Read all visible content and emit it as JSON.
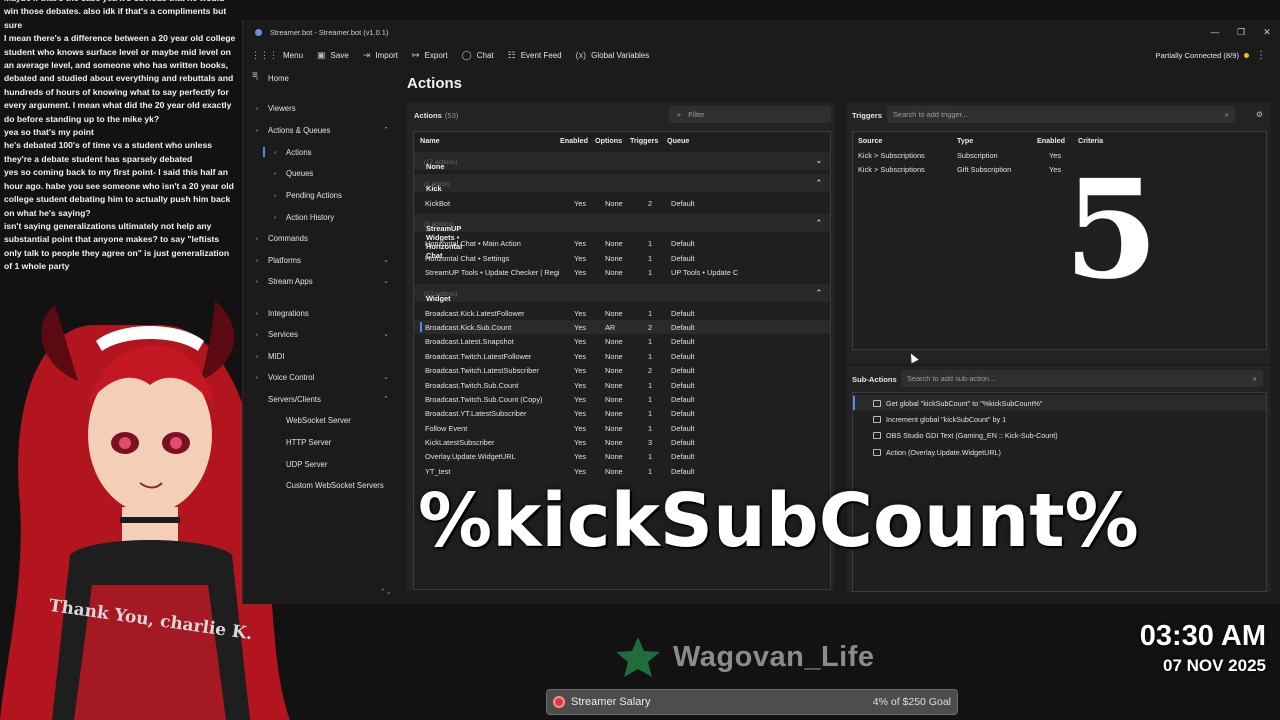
{
  "chat": {
    "messages": [
      "Maybe if that's the case yea it's obvious that he would win those debates. also idk if that's a compliments but sure",
      "I mean there's a difference between a 20 year old college student who knows surface level or maybe mid level on an average level, and someone who has written books, debated and studied about everything and rebuttals and hundreds of hours of knowing what to say perfectly for every argument. I mean what did the 20 year old exactly do before standing up to the mike yk?",
      "yea so that's my point",
      "he's debated 100's of time vs a student who unless they're a debate student has sparsely debated",
      "yes so coming back to my first point- I said this half an hour ago. habe you see someone who isn't a 20 year old college student debating him to actually push him back on what he's saying?",
      "isn't saying generalizations ultimately not help any substantial point that anyone makes? to say \"leftists only talk to people they agree on\" is just generalization of 1 whole party"
    ]
  },
  "window": {
    "title": "Streamer.bot - Streamer.bot (v1.0.1)",
    "controls": [
      "—",
      "❐",
      "✕"
    ]
  },
  "toolbar": {
    "items": [
      {
        "label": "Menu",
        "icon": "grid-icon"
      },
      {
        "label": "Save",
        "icon": "save-icon"
      },
      {
        "label": "Import",
        "icon": "import-icon"
      },
      {
        "label": "Export",
        "icon": "export-icon"
      },
      {
        "label": "Chat",
        "icon": "chat-icon"
      },
      {
        "label": "Event Feed",
        "icon": "event-feed-icon"
      },
      {
        "label": "Global Variables",
        "icon": "variables-icon"
      }
    ],
    "connection_status": "Partially Connected (8/9)",
    "connection_color": "#e5c31d"
  },
  "sidebar": {
    "items": [
      {
        "label": "Home",
        "icon": "home-icon",
        "active": false
      },
      {
        "label": "Viewers",
        "icon": "viewers-icon",
        "active": false
      },
      {
        "label": "Actions & Queues",
        "icon": "actions-icon",
        "active": false,
        "expanded": true
      },
      {
        "label": "Actions",
        "icon": "action-icon",
        "active": true
      },
      {
        "label": "Queues",
        "icon": "queue-icon",
        "active": false
      },
      {
        "label": "Pending Actions",
        "icon": "pending-icon",
        "active": false
      },
      {
        "label": "Action History",
        "icon": "history-icon",
        "active": false
      },
      {
        "label": "Commands",
        "icon": "commands-icon",
        "active": false
      },
      {
        "label": "Platforms",
        "icon": "platforms-icon",
        "active": false,
        "expanded": false
      },
      {
        "label": "Stream Apps",
        "icon": "stream-apps-icon",
        "active": false,
        "expanded": false
      },
      {
        "label": "Integrations",
        "icon": "integrations-icon",
        "active": false
      },
      {
        "label": "Services",
        "icon": "services-icon",
        "active": false,
        "expanded": false
      },
      {
        "label": "MIDI",
        "icon": "midi-icon",
        "active": false
      },
      {
        "label": "Voice Control",
        "icon": "voice-icon",
        "active": false,
        "expanded": false
      },
      {
        "label": "Servers/Clients",
        "icon": "",
        "active": false,
        "expanded": true
      },
      {
        "label": "WebSocket Server",
        "icon": "",
        "active": false
      },
      {
        "label": "HTTP Server",
        "icon": "",
        "active": false
      },
      {
        "label": "UDP Server",
        "icon": "",
        "active": false
      },
      {
        "label": "Custom WebSocket Servers",
        "icon": "",
        "active": false
      }
    ]
  },
  "page_title": "Actions",
  "actions": {
    "header_label": "Actions",
    "count": "(53)",
    "filter_placeholder": "Filter",
    "columns": [
      "Name",
      "Enabled",
      "Options",
      "Triggers",
      "Queue"
    ],
    "groups": [
      {
        "name": "None",
        "count": "(17 actions)",
        "chevron": "⌄",
        "rows": []
      },
      {
        "name": "Kick",
        "count": "(1 action)",
        "chevron": "⌃",
        "rows": [
          {
            "name": "KickBot",
            "enabled": "Yes",
            "options": "None",
            "triggers": "2",
            "queue": "Default",
            "selected": false
          }
        ]
      },
      {
        "name": "StreamUP Widgets • Horizontal Chat",
        "count": "(3 actions)",
        "chevron": "⌃",
        "rows": [
          {
            "name": "Horizontal Chat • Main Action",
            "enabled": "Yes",
            "options": "None",
            "triggers": "1",
            "queue": "Default",
            "selected": false
          },
          {
            "name": "Horizontal Chat • Settings",
            "enabled": "Yes",
            "options": "None",
            "triggers": "1",
            "queue": "Default",
            "selected": false
          },
          {
            "name": "StreamUP Tools • Update Checker | Regi",
            "enabled": "Yes",
            "options": "None",
            "triggers": "1",
            "queue": "UP Tools • Update C",
            "selected": false
          }
        ]
      },
      {
        "name": "Widget",
        "count": "(12 actions)",
        "chevron": "⌃",
        "rows": [
          {
            "name": "Broadcast.Kick.LatestFollower",
            "enabled": "Yes",
            "options": "None",
            "triggers": "1",
            "queue": "Default",
            "selected": false
          },
          {
            "name": "Broadcast.Kick.Sub.Count",
            "enabled": "Yes",
            "options": "AR",
            "triggers": "2",
            "queue": "Default",
            "selected": true
          },
          {
            "name": "Broadcast.Latest.Snapshot",
            "enabled": "Yes",
            "options": "None",
            "triggers": "1",
            "queue": "Default",
            "selected": false
          },
          {
            "name": "Broadcast.Twitch.LatestFollower",
            "enabled": "Yes",
            "options": "None",
            "triggers": "1",
            "queue": "Default",
            "selected": false
          },
          {
            "name": "Broadcast.Twitch.LatestSubscriber",
            "enabled": "Yes",
            "options": "None",
            "triggers": "2",
            "queue": "Default",
            "selected": false
          },
          {
            "name": "Broadcast.Twitch.Sub.Count",
            "enabled": "Yes",
            "options": "None",
            "triggers": "1",
            "queue": "Default",
            "selected": false
          },
          {
            "name": "Broadcast.Twitch.Sub.Count (Copy)",
            "enabled": "Yes",
            "options": "None",
            "triggers": "1",
            "queue": "Default",
            "selected": false
          },
          {
            "name": "Broadcast.YT.LatestSubscriber",
            "enabled": "Yes",
            "options": "None",
            "triggers": "1",
            "queue": "Default",
            "selected": false
          },
          {
            "name": "Follow Event",
            "enabled": "Yes",
            "options": "None",
            "triggers": "1",
            "queue": "Default",
            "selected": false
          },
          {
            "name": "KickLatestSubscriber",
            "enabled": "Yes",
            "options": "None",
            "triggers": "3",
            "queue": "Default",
            "selected": false
          },
          {
            "name": "Overlay.Update.WidgetURL",
            "enabled": "Yes",
            "options": "None",
            "triggers": "1",
            "queue": "Default",
            "selected": false
          },
          {
            "name": "YT_test",
            "enabled": "Yes",
            "options": "None",
            "triggers": "1",
            "queue": "Default",
            "selected": false
          }
        ]
      }
    ]
  },
  "triggers": {
    "header_label": "Triggers",
    "search_placeholder": "Search to add trigger...",
    "columns": [
      "Source",
      "Type",
      "Enabled",
      "Criteria"
    ],
    "rows": [
      {
        "source": "Kick > Subscriptions",
        "type": "Subscription",
        "enabled": "Yes",
        "criteria": ""
      },
      {
        "source": "Kick > Subscriptions",
        "type": "Gift Subscription",
        "enabled": "Yes",
        "criteria": ""
      }
    ]
  },
  "subactions": {
    "header_label": "Sub-Actions",
    "search_placeholder": "Search to add sub-action...",
    "items": [
      "Get global \"kickSubCount\" to \"%kickSubCount%\"",
      "Increment global \"kickSubCount\" by 1",
      "OBS Studio GDI Text (Gaming_EN :: Kick-Sub-Count)",
      "Action (Overlay.Update.WidgetURL)"
    ]
  },
  "overlay": {
    "big_number": "5",
    "variable_text": "%kickSubCount%",
    "brand_name": "Wagovan_Life",
    "brand_color": "#1f6d3a",
    "clock_time": "03:30 AM",
    "clock_date": "07 NOV 2025",
    "salary_label": "Streamer Salary",
    "salary_goal": "4% of $250 Goal",
    "salary_progress": 0.04,
    "shirt_text": "Thank You, charlie K."
  }
}
